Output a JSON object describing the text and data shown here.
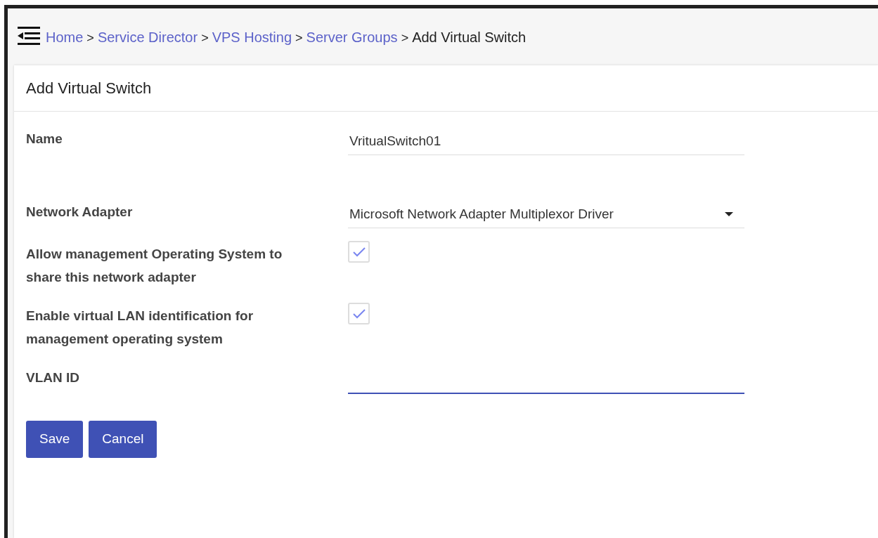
{
  "breadcrumb": [
    {
      "label": "Home",
      "link": true
    },
    {
      "label": "Service Director",
      "link": true
    },
    {
      "label": "VPS Hosting",
      "link": true
    },
    {
      "label": "Server Groups",
      "link": true
    },
    {
      "label": "Add Virtual Switch",
      "link": false
    }
  ],
  "breadcrumb_separator": ">",
  "card": {
    "title": "Add Virtual Switch"
  },
  "fields": [
    {
      "kind": "text",
      "label": "Name",
      "value": "VritualSwitch01",
      "focused": false
    },
    {
      "kind": "select",
      "label": "Network Adapter",
      "value": "Microsoft Network Adapter Multiplexor Driver",
      "focused": false
    },
    {
      "kind": "checkbox",
      "label": "Allow management Operating System to share this network adapter",
      "checked": true
    },
    {
      "kind": "checkbox",
      "label": "Enable virtual LAN identification for management operating system",
      "checked": true
    },
    {
      "kind": "text",
      "label": "VLAN ID",
      "focused": true
    }
  ],
  "buttons": [
    {
      "label": "Save"
    },
    {
      "label": "Cancel"
    }
  ]
}
